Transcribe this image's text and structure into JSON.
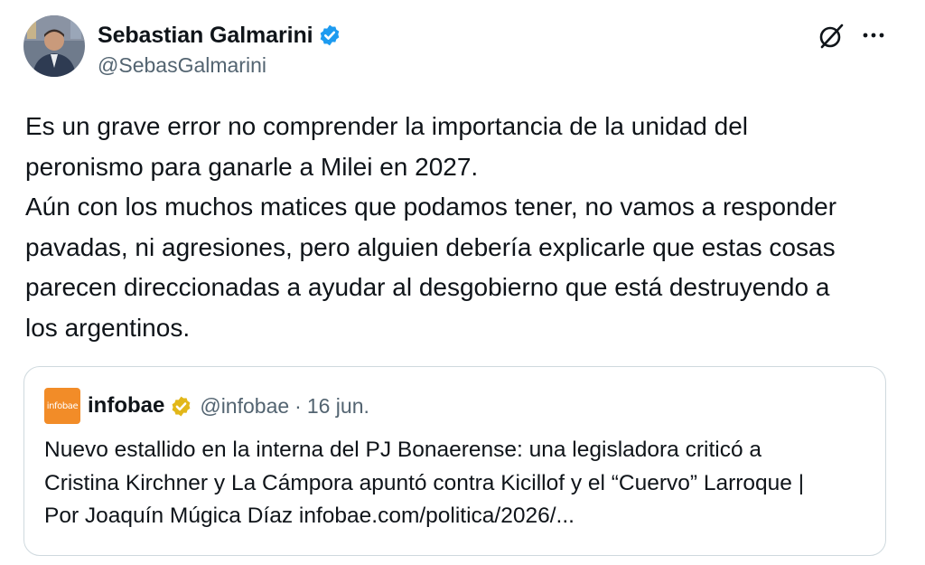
{
  "author": {
    "display_name": "Sebastian Galmarini",
    "handle": "@SebasGalmarini",
    "verified_badge_color": "#1d9bf0"
  },
  "tweet": {
    "lines": [
      "Es un grave error no comprender la importancia de la unidad del",
      "peronismo para ganarle a Milei en 2027.",
      "Aún con los muchos matices que podamos tener, no vamos a responder",
      "pavadas, ni agresiones, pero alguien debería explicarle que estas cosas",
      "parecen direccionadas a ayudar al desgobierno que está destruyendo a",
      "los argentinos."
    ]
  },
  "quoted": {
    "logo_text": "infobae",
    "logo_color": "#f28c28",
    "name": "infobae",
    "badge_color": "#e2b719",
    "handle": "@infobae",
    "separator": "·",
    "date": "16 jun.",
    "lines": [
      "Nuevo estallido en la interna del PJ Bonaerense: una legisladora criticó a",
      "Cristina Kirchner y La Cámpora apuntó contra Kicillof y el “Cuervo” Larroque |",
      "Por Joaquín Múgica Díaz infobae.com/politica/2026/..."
    ]
  },
  "icons": {
    "grok": "grok-icon",
    "more": "more-options-icon"
  }
}
